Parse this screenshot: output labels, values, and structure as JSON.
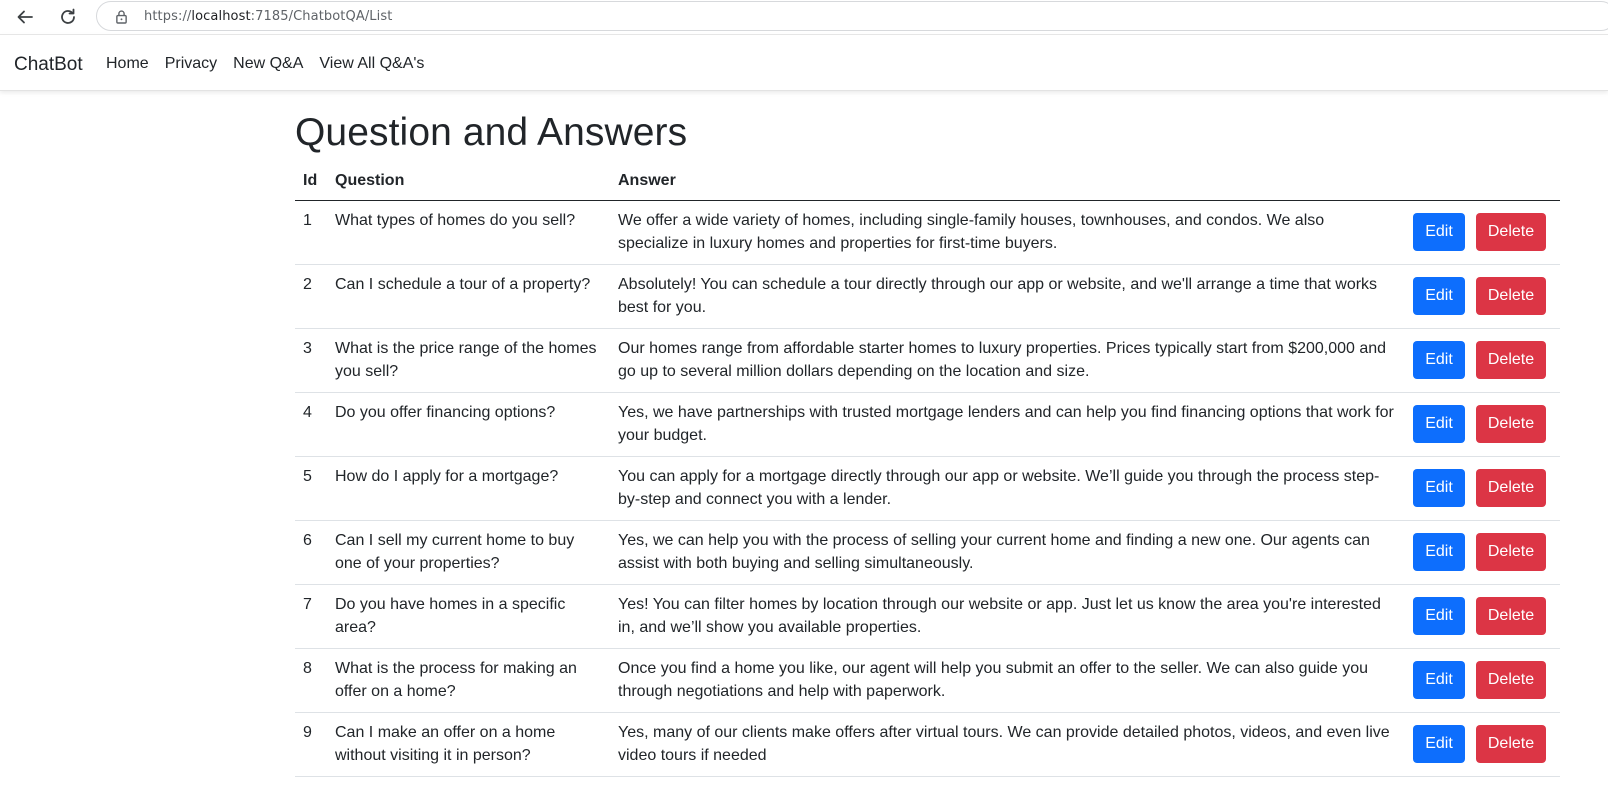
{
  "browser": {
    "url_prefix": "https://",
    "url_host": "localhost",
    "url_rest": ":7185/ChatbotQA/List"
  },
  "navbar": {
    "brand": "ChatBot",
    "links": [
      "Home",
      "Privacy",
      "New Q&A",
      "View All Q&A's"
    ]
  },
  "page": {
    "title": "Question and Answers"
  },
  "table": {
    "headers": {
      "id": "Id",
      "question": "Question",
      "answer": "Answer"
    },
    "edit_label": "Edit",
    "delete_label": "Delete",
    "rows": [
      {
        "id": "1",
        "question": "What types of homes do you sell?",
        "answer": "We offer a wide variety of homes, including single-family houses, townhouses, and condos. We also specialize in luxury homes and properties for first-time buyers."
      },
      {
        "id": "2",
        "question": "Can I schedule a tour of a property?",
        "answer": "Absolutely! You can schedule a tour directly through our app or website, and we'll arrange a time that works best for you."
      },
      {
        "id": "3",
        "question": "What is the price range of the homes you sell?",
        "answer": "Our homes range from affordable starter homes to luxury properties. Prices typically start from $200,000 and go up to several million dollars depending on the location and size."
      },
      {
        "id": "4",
        "question": "Do you offer financing options?",
        "answer": "Yes, we have partnerships with trusted mortgage lenders and can help you find financing options that work for your budget."
      },
      {
        "id": "5",
        "question": "How do I apply for a mortgage?",
        "answer": "You can apply for a mortgage directly through our app or website. We’ll guide you through the process step-by-step and connect you with a lender."
      },
      {
        "id": "6",
        "question": "Can I sell my current home to buy one of your properties?",
        "answer": "Yes, we can help you with the process of selling your current home and finding a new one. Our agents can assist with both buying and selling simultaneously."
      },
      {
        "id": "7",
        "question": "Do you have homes in a specific area?",
        "answer": "Yes! You can filter homes by location through our website or app. Just let us know the area you're interested in, and we’ll show you available properties."
      },
      {
        "id": "8",
        "question": "What is the process for making an offer on a home?",
        "answer": "Once you find a home you like, our agent will help you submit an offer to the seller. We can also guide you through negotiations and help with paperwork."
      },
      {
        "id": "9",
        "question": "Can I make an offer on a home without visiting it in person?",
        "answer": "Yes, many of our clients make offers after virtual tours. We can provide detailed photos, videos, and even live video tours if needed"
      }
    ]
  }
}
